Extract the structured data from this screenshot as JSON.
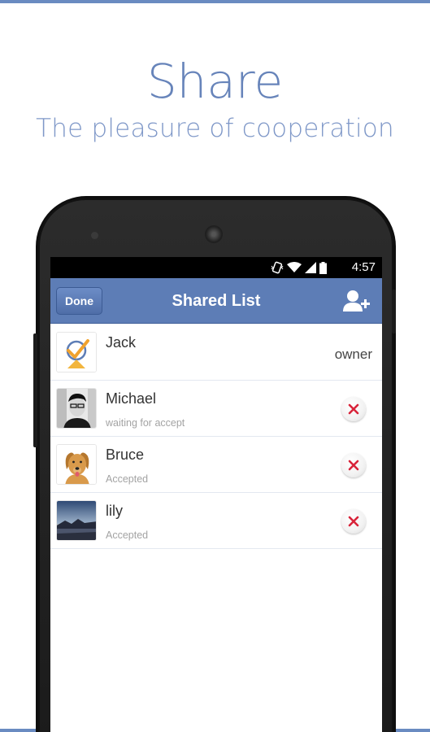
{
  "promo": {
    "title": "Share",
    "subtitle": "The pleasure of cooperation"
  },
  "status_bar": {
    "time": "4:57",
    "icons": [
      "vibrate-icon",
      "wifi-icon",
      "signal-icon",
      "battery-icon"
    ]
  },
  "nav": {
    "done_label": "Done",
    "title": "Shared List",
    "add_icon": "add-user-icon"
  },
  "members": [
    {
      "name": "Jack",
      "status": "",
      "role": "owner",
      "avatar": "app-logo"
    },
    {
      "name": "Michael",
      "status": "waiting for accept",
      "role": "",
      "avatar": "photo-person"
    },
    {
      "name": "Bruce",
      "status": "Accepted",
      "role": "",
      "avatar": "photo-dog"
    },
    {
      "name": "lily",
      "status": "Accepted",
      "role": "",
      "avatar": "photo-sunset"
    }
  ],
  "colors": {
    "accent": "#5d7db6",
    "promo_text": "#6784ba",
    "remove": "#d8243a"
  }
}
